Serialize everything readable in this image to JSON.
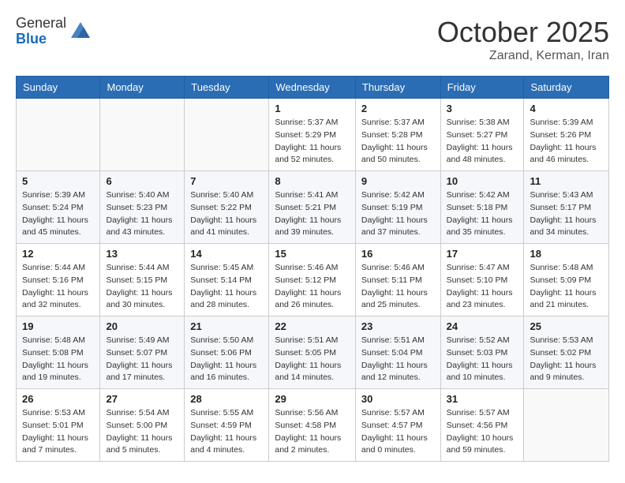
{
  "header": {
    "logo_general": "General",
    "logo_blue": "Blue",
    "month_title": "October 2025",
    "location": "Zarand, Kerman, Iran"
  },
  "days_of_week": [
    "Sunday",
    "Monday",
    "Tuesday",
    "Wednesday",
    "Thursday",
    "Friday",
    "Saturday"
  ],
  "weeks": [
    [
      {
        "num": "",
        "info": ""
      },
      {
        "num": "",
        "info": ""
      },
      {
        "num": "",
        "info": ""
      },
      {
        "num": "1",
        "info": "Sunrise: 5:37 AM\nSunset: 5:29 PM\nDaylight: 11 hours and 52 minutes."
      },
      {
        "num": "2",
        "info": "Sunrise: 5:37 AM\nSunset: 5:28 PM\nDaylight: 11 hours and 50 minutes."
      },
      {
        "num": "3",
        "info": "Sunrise: 5:38 AM\nSunset: 5:27 PM\nDaylight: 11 hours and 48 minutes."
      },
      {
        "num": "4",
        "info": "Sunrise: 5:39 AM\nSunset: 5:26 PM\nDaylight: 11 hours and 46 minutes."
      }
    ],
    [
      {
        "num": "5",
        "info": "Sunrise: 5:39 AM\nSunset: 5:24 PM\nDaylight: 11 hours and 45 minutes."
      },
      {
        "num": "6",
        "info": "Sunrise: 5:40 AM\nSunset: 5:23 PM\nDaylight: 11 hours and 43 minutes."
      },
      {
        "num": "7",
        "info": "Sunrise: 5:40 AM\nSunset: 5:22 PM\nDaylight: 11 hours and 41 minutes."
      },
      {
        "num": "8",
        "info": "Sunrise: 5:41 AM\nSunset: 5:21 PM\nDaylight: 11 hours and 39 minutes."
      },
      {
        "num": "9",
        "info": "Sunrise: 5:42 AM\nSunset: 5:19 PM\nDaylight: 11 hours and 37 minutes."
      },
      {
        "num": "10",
        "info": "Sunrise: 5:42 AM\nSunset: 5:18 PM\nDaylight: 11 hours and 35 minutes."
      },
      {
        "num": "11",
        "info": "Sunrise: 5:43 AM\nSunset: 5:17 PM\nDaylight: 11 hours and 34 minutes."
      }
    ],
    [
      {
        "num": "12",
        "info": "Sunrise: 5:44 AM\nSunset: 5:16 PM\nDaylight: 11 hours and 32 minutes."
      },
      {
        "num": "13",
        "info": "Sunrise: 5:44 AM\nSunset: 5:15 PM\nDaylight: 11 hours and 30 minutes."
      },
      {
        "num": "14",
        "info": "Sunrise: 5:45 AM\nSunset: 5:14 PM\nDaylight: 11 hours and 28 minutes."
      },
      {
        "num": "15",
        "info": "Sunrise: 5:46 AM\nSunset: 5:12 PM\nDaylight: 11 hours and 26 minutes."
      },
      {
        "num": "16",
        "info": "Sunrise: 5:46 AM\nSunset: 5:11 PM\nDaylight: 11 hours and 25 minutes."
      },
      {
        "num": "17",
        "info": "Sunrise: 5:47 AM\nSunset: 5:10 PM\nDaylight: 11 hours and 23 minutes."
      },
      {
        "num": "18",
        "info": "Sunrise: 5:48 AM\nSunset: 5:09 PM\nDaylight: 11 hours and 21 minutes."
      }
    ],
    [
      {
        "num": "19",
        "info": "Sunrise: 5:48 AM\nSunset: 5:08 PM\nDaylight: 11 hours and 19 minutes."
      },
      {
        "num": "20",
        "info": "Sunrise: 5:49 AM\nSunset: 5:07 PM\nDaylight: 11 hours and 17 minutes."
      },
      {
        "num": "21",
        "info": "Sunrise: 5:50 AM\nSunset: 5:06 PM\nDaylight: 11 hours and 16 minutes."
      },
      {
        "num": "22",
        "info": "Sunrise: 5:51 AM\nSunset: 5:05 PM\nDaylight: 11 hours and 14 minutes."
      },
      {
        "num": "23",
        "info": "Sunrise: 5:51 AM\nSunset: 5:04 PM\nDaylight: 11 hours and 12 minutes."
      },
      {
        "num": "24",
        "info": "Sunrise: 5:52 AM\nSunset: 5:03 PM\nDaylight: 11 hours and 10 minutes."
      },
      {
        "num": "25",
        "info": "Sunrise: 5:53 AM\nSunset: 5:02 PM\nDaylight: 11 hours and 9 minutes."
      }
    ],
    [
      {
        "num": "26",
        "info": "Sunrise: 5:53 AM\nSunset: 5:01 PM\nDaylight: 11 hours and 7 minutes."
      },
      {
        "num": "27",
        "info": "Sunrise: 5:54 AM\nSunset: 5:00 PM\nDaylight: 11 hours and 5 minutes."
      },
      {
        "num": "28",
        "info": "Sunrise: 5:55 AM\nSunset: 4:59 PM\nDaylight: 11 hours and 4 minutes."
      },
      {
        "num": "29",
        "info": "Sunrise: 5:56 AM\nSunset: 4:58 PM\nDaylight: 11 hours and 2 minutes."
      },
      {
        "num": "30",
        "info": "Sunrise: 5:57 AM\nSunset: 4:57 PM\nDaylight: 11 hours and 0 minutes."
      },
      {
        "num": "31",
        "info": "Sunrise: 5:57 AM\nSunset: 4:56 PM\nDaylight: 10 hours and 59 minutes."
      },
      {
        "num": "",
        "info": ""
      }
    ]
  ]
}
